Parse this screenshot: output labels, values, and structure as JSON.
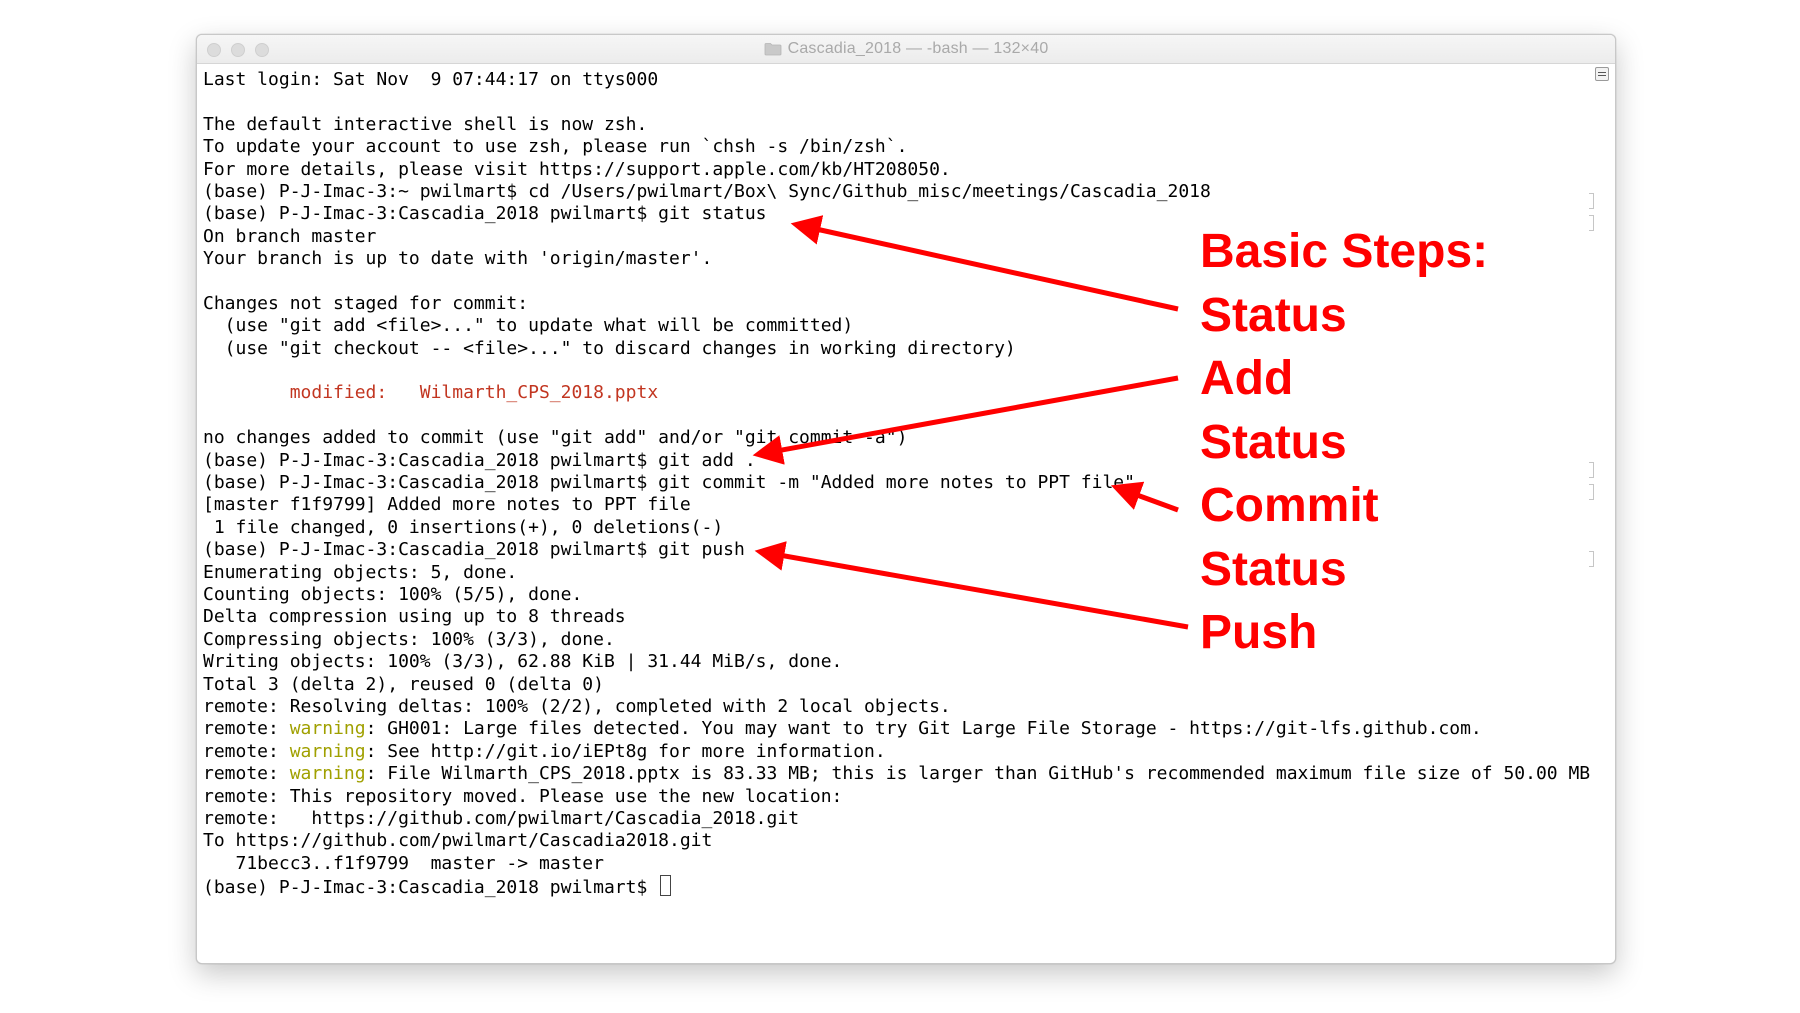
{
  "window": {
    "title": "Cascadia_2018 — -bash — 132×40"
  },
  "terminal": {
    "lines": [
      {
        "text": "Last login: Sat Nov  9 07:44:17 on ttys000"
      },
      {
        "text": ""
      },
      {
        "text": "The default interactive shell is now zsh."
      },
      {
        "text": "To update your account to use zsh, please run `chsh -s /bin/zsh`."
      },
      {
        "text": "For more details, please visit https://support.apple.com/kb/HT208050."
      },
      {
        "text": "(base) P-J-Imac-3:~ pwilmart$ cd /Users/pwilmart/Box\\ Sync/Github_misc/meetings/Cascadia_2018"
      },
      {
        "text": "(base) P-J-Imac-3:Cascadia_2018 pwilmart$ git status"
      },
      {
        "text": "On branch master"
      },
      {
        "text": "Your branch is up to date with 'origin/master'."
      },
      {
        "text": ""
      },
      {
        "text": "Changes not staged for commit:"
      },
      {
        "text": "  (use \"git add <file>...\" to update what will be committed)"
      },
      {
        "text": "  (use \"git checkout -- <file>...\" to discard changes in working directory)"
      },
      {
        "text": ""
      },
      {
        "text": "        modified:   Wilmarth_CPS_2018.pptx",
        "style": "red"
      },
      {
        "text": ""
      },
      {
        "text": "no changes added to commit (use \"git add\" and/or \"git commit -a\")"
      },
      {
        "text": "(base) P-J-Imac-3:Cascadia_2018 pwilmart$ git add ."
      },
      {
        "text": "(base) P-J-Imac-3:Cascadia_2018 pwilmart$ git commit -m \"Added more notes to PPT file\""
      },
      {
        "text": "[master f1f9799] Added more notes to PPT file"
      },
      {
        "text": " 1 file changed, 0 insertions(+), 0 deletions(-)"
      },
      {
        "text": "(base) P-J-Imac-3:Cascadia_2018 pwilmart$ git push"
      },
      {
        "text": "Enumerating objects: 5, done."
      },
      {
        "text": "Counting objects: 100% (5/5), done."
      },
      {
        "text": "Delta compression using up to 8 threads"
      },
      {
        "text": "Compressing objects: 100% (3/3), done."
      },
      {
        "text": "Writing objects: 100% (3/3), 62.88 KiB | 31.44 MiB/s, done."
      },
      {
        "text": "Total 3 (delta 2), reused 0 (delta 0)"
      },
      {
        "text": "remote: Resolving deltas: 100% (2/2), completed with 2 local objects."
      },
      {
        "prefix": "remote: ",
        "highlight": "warning",
        "rest": ": GH001: Large files detected. You may want to try Git Large File Storage - https://git-lfs.github.com."
      },
      {
        "prefix": "remote: ",
        "highlight": "warning",
        "rest": ": See http://git.io/iEPt8g for more information."
      },
      {
        "prefix": "remote: ",
        "highlight": "warning",
        "rest": ": File Wilmarth_CPS_2018.pptx is 83.33 MB; this is larger than GitHub's recommended maximum file size of 50.00 MB"
      },
      {
        "text": "remote: This repository moved. Please use the new location:"
      },
      {
        "text": "remote:   https://github.com/pwilmart/Cascadia_2018.git"
      },
      {
        "text": "To https://github.com/pwilmart/Cascadia2018.git"
      },
      {
        "text": "   71becc3..f1f9799  master -> master"
      },
      {
        "text": "(base) P-J-Imac-3:Cascadia_2018 pwilmart$ ",
        "cursor": true
      }
    ]
  },
  "annotations": {
    "heading": "Basic Steps:",
    "steps": [
      "Status",
      "Add",
      "Status",
      "Commit",
      "Status",
      "Push"
    ]
  },
  "colors": {
    "annotation": "#ff0000",
    "modified": "#c23621",
    "warning": "#a0a000"
  }
}
